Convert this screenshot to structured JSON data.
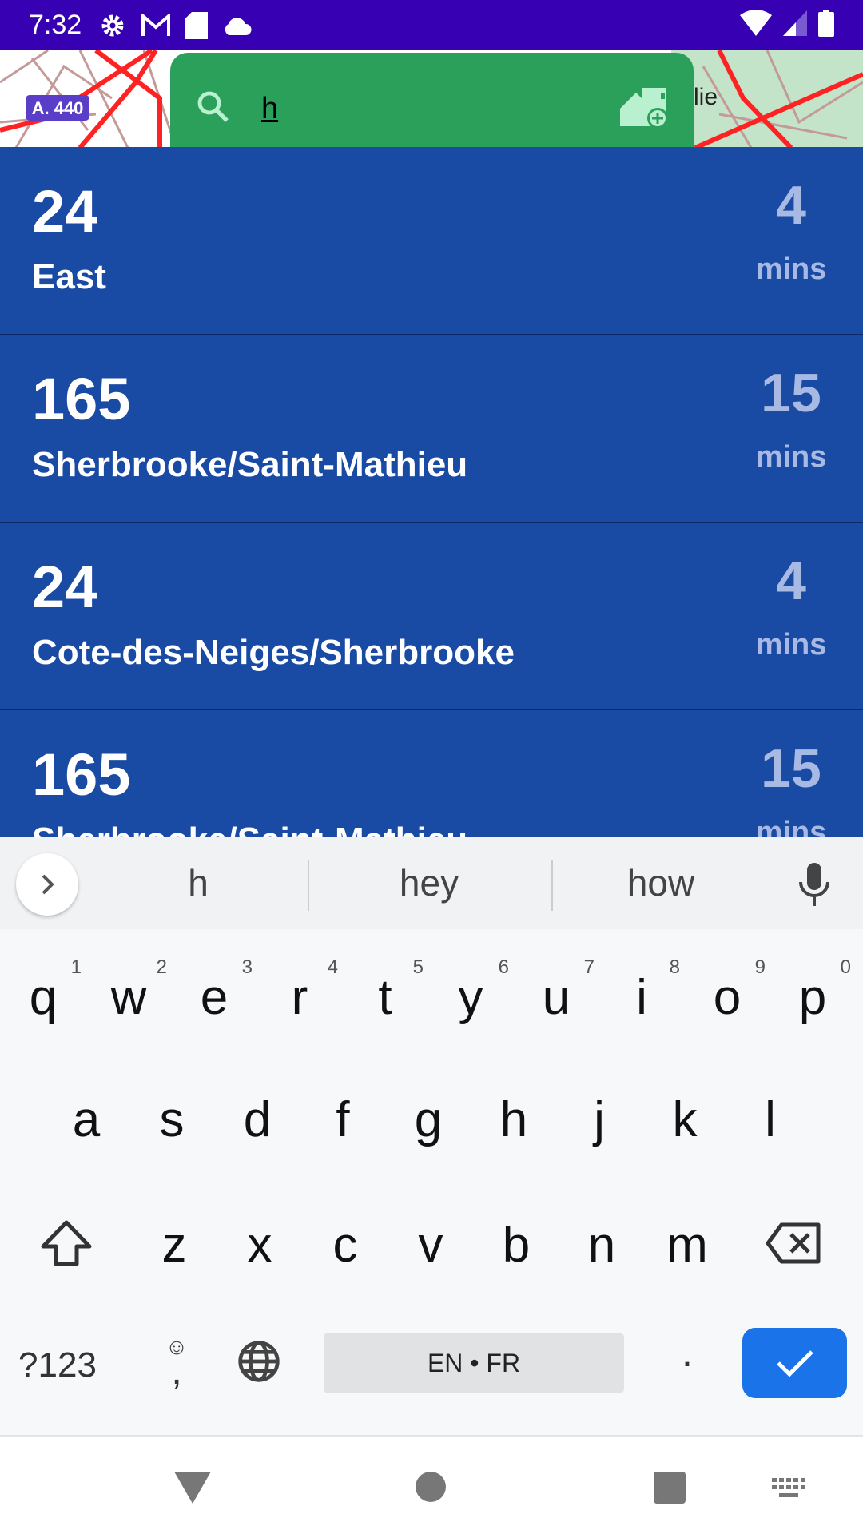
{
  "status_bar": {
    "time": "7:32",
    "icons": [
      "gear-icon",
      "gmail-icon",
      "sd-card-icon",
      "cloud-icon"
    ],
    "right_icons": [
      "wifi-icon",
      "signal-icon",
      "battery-icon"
    ]
  },
  "map": {
    "route_label": "A. 440",
    "place_fragment": "lie"
  },
  "search": {
    "query": "h",
    "icons": [
      "search-icon",
      "add-home-icon"
    ]
  },
  "colors": {
    "status_bar": "#3700b3",
    "search_bg": "#2ba05a",
    "list_bg": "#1a4ba4",
    "minutes": "#a8b9e4",
    "enter_key": "#1a73e8"
  },
  "arrivals": [
    {
      "route": "24",
      "direction": "East",
      "minutes": "4",
      "unit": "mins"
    },
    {
      "route": "165",
      "direction": "Sherbrooke/Saint-Mathieu",
      "minutes": "15",
      "unit": "mins"
    },
    {
      "route": "24",
      "direction": "Cote-des-Neiges/Sherbrooke",
      "minutes": "4",
      "unit": "mins"
    },
    {
      "route": "165",
      "direction": "Sherbrooke/Saint-Mathieu",
      "minutes": "15",
      "unit": "mins"
    }
  ],
  "keyboard": {
    "suggestions": [
      "h",
      "hey",
      "how"
    ],
    "row1": [
      "q",
      "w",
      "e",
      "r",
      "t",
      "y",
      "u",
      "i",
      "o",
      "p"
    ],
    "row1_hints": [
      "1",
      "2",
      "3",
      "4",
      "5",
      "6",
      "7",
      "8",
      "9",
      "0"
    ],
    "row2": [
      "a",
      "s",
      "d",
      "f",
      "g",
      "h",
      "j",
      "k",
      "l"
    ],
    "row3": [
      "z",
      "x",
      "c",
      "v",
      "b",
      "n",
      "m"
    ],
    "symbols_label": "?123",
    "comma": ",",
    "period": ".",
    "space_label": "EN • FR"
  }
}
